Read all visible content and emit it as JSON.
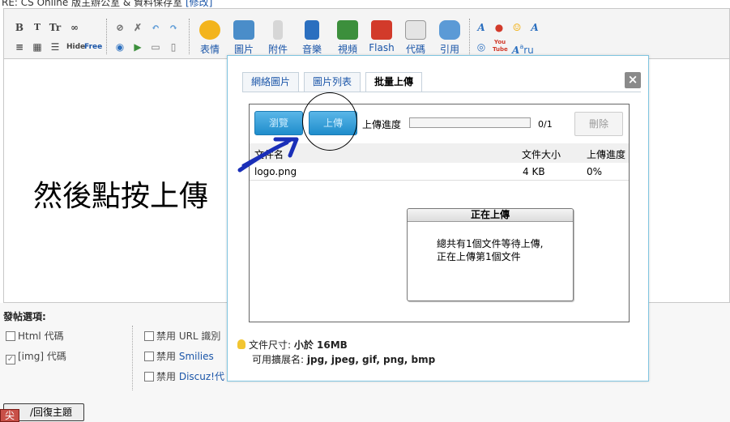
{
  "page": {
    "title_line": "RE: CS Online 版主辦公室 & 資料保存室",
    "edit_link": "[修改]"
  },
  "toolbar": {
    "big_buttons": [
      {
        "label": "表情",
        "icon": "smiley-icon",
        "color": "#f3b41c"
      },
      {
        "label": "圖片",
        "icon": "picture-icon",
        "color": "#4a8dc9"
      },
      {
        "label": "附件",
        "icon": "paperclip-icon",
        "color": "#9a9a9a"
      },
      {
        "label": "音樂",
        "icon": "music-note-icon",
        "color": "#2b6fbf"
      },
      {
        "label": "視頻",
        "icon": "video-icon",
        "color": "#3c8f3c"
      },
      {
        "label": "Flash",
        "icon": "flash-icon",
        "color": "#d23a2a"
      },
      {
        "label": "代碼",
        "icon": "code-icon",
        "color": "#888888"
      },
      {
        "label": "引用",
        "icon": "quote-icon",
        "color": "#5b9ad6"
      }
    ],
    "small_labels": [
      "B",
      "T",
      "Tr",
      "Hide",
      "Free"
    ],
    "right_labels": [
      "A",
      "A",
      "ru"
    ],
    "youtube_label": "You Tube"
  },
  "editor": {
    "content": "然後點按上傳"
  },
  "options": {
    "title": "發帖選項:",
    "html_code": "Html 代碼",
    "img_code": "[img] 代碼",
    "disable_url": "禁用 URL 識別",
    "disable_smilies_prefix": "禁用 ",
    "disable_smilies_link": "Smilies",
    "disable_discuz_prefix": "禁用 ",
    "disable_discuz_link": "Discuz!代",
    "reply_button": "/回復主題",
    "red_box": "尖"
  },
  "dialog": {
    "tabs": [
      {
        "label": "網絡圖片",
        "active": false
      },
      {
        "label": "圖片列表",
        "active": false
      },
      {
        "label": "批量上傳",
        "active": true
      }
    ],
    "close_glyph": "×",
    "browse_label": "瀏覽",
    "upload_label": "上傳",
    "progress_label": "上傳進度",
    "progress_value": 0,
    "progress_count": "0/1",
    "delete_label": "刪除",
    "table_headers": [
      "文件名",
      "文件大小",
      "上傳進度"
    ],
    "rows": [
      {
        "name": "logo.png",
        "size": "4 KB",
        "progress": "0%"
      }
    ],
    "status": {
      "title": "正在上傳",
      "line1": "總共有1個文件等待上傳,",
      "line2": "正在上傳第1個文件"
    },
    "info": {
      "size_label": "文件尺寸: ",
      "size_value": "小於 16MB",
      "ext_label": "可用擴展名: ",
      "ext_value": "jpg, jpeg, gif, png, bmp"
    }
  },
  "colors": {
    "accent": "#1a55a8",
    "button_blue": "#1f8dcc",
    "annotation_arrow": "#1a2fb8"
  }
}
